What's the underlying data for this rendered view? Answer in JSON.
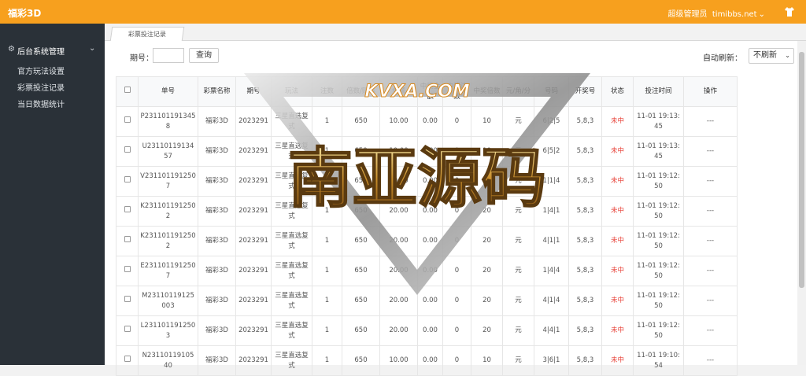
{
  "app": {
    "brand": "福彩3D",
    "user": "超级管理员",
    "site": "timibbs.net"
  },
  "sidebar": {
    "group": "后台系统管理",
    "items": [
      {
        "label": "官方玩法设置"
      },
      {
        "label": "彩票投注记录"
      },
      {
        "label": "当日数据统计"
      }
    ]
  },
  "tab": {
    "label": "彩票投注记录"
  },
  "filter": {
    "issue_label": "期号：",
    "issue_value": "",
    "query_label": "查询"
  },
  "autorefresh": {
    "label": "自动刷新：",
    "value": "不刷新"
  },
  "table": {
    "headers": [
      "",
      "单号",
      "彩票名称",
      "期号",
      "玩法",
      "注数",
      "倍数/赔率",
      "金额",
      "中奖金额",
      "中奖注数",
      "中奖倍数",
      "元/角/分",
      "号码",
      "开奖号",
      "状态",
      "投注时间",
      "操作"
    ],
    "rows": [
      [
        "",
        "P2311011913458",
        "福彩3D",
        "2023291",
        "三星直选复式",
        "1",
        "650",
        "10.00",
        "0.00",
        "0",
        "10",
        "元",
        "6|2|5",
        "5,8,3",
        "未中",
        "11-01 19:13:45",
        "---"
      ],
      [
        "",
        "U2311011913457",
        "福彩3D",
        "2023291",
        "三星直选复式",
        "1",
        "650",
        "10.00",
        "0.00",
        "0",
        "10",
        "元",
        "6|5|2",
        "5,8,3",
        "未中",
        "11-01 19:13:45",
        "---"
      ],
      [
        "",
        "V2311011912507",
        "福彩3D",
        "2023291",
        "三星直选复式",
        "1",
        "650",
        "20.00",
        "0.00",
        "0",
        "20",
        "元",
        "1|1|4",
        "5,8,3",
        "未中",
        "11-01 19:12:50",
        "---"
      ],
      [
        "",
        "K2311011912502",
        "福彩3D",
        "2023291",
        "三星直选复式",
        "1",
        "650",
        "20.00",
        "0.00",
        "0",
        "20",
        "元",
        "1|4|1",
        "5,8,3",
        "未中",
        "11-01 19:12:50",
        "---"
      ],
      [
        "",
        "K2311011912502",
        "福彩3D",
        "2023291",
        "三星直选复式",
        "1",
        "650",
        "20.00",
        "0.00",
        "0",
        "20",
        "元",
        "4|1|1",
        "5,8,3",
        "未中",
        "11-01 19:12:50",
        "---"
      ],
      [
        "",
        "E2311011912507",
        "福彩3D",
        "2023291",
        "三星直选复式",
        "1",
        "650",
        "20.00",
        "0.00",
        "0",
        "20",
        "元",
        "1|4|4",
        "5,8,3",
        "未中",
        "11-01 19:12:50",
        "---"
      ],
      [
        "",
        "M23110119125003",
        "福彩3D",
        "2023291",
        "三星直选复式",
        "1",
        "650",
        "20.00",
        "0.00",
        "0",
        "20",
        "元",
        "4|1|4",
        "5,8,3",
        "未中",
        "11-01 19:12:50",
        "---"
      ],
      [
        "",
        "L2311011912503",
        "福彩3D",
        "2023291",
        "三星直选复式",
        "1",
        "650",
        "20.00",
        "0.00",
        "0",
        "20",
        "元",
        "4|4|1",
        "5,8,3",
        "未中",
        "11-01 19:12:50",
        "---"
      ],
      [
        "",
        "N2311011910540",
        "福彩3D",
        "2023291",
        "三星直选复式",
        "1",
        "650",
        "10.00",
        "0.00",
        "0",
        "10",
        "元",
        "3|6|1",
        "5,8,3",
        "未中",
        "11-01 19:10:54",
        "---"
      ]
    ]
  },
  "watermark": {
    "top_text": "KVXA.COM",
    "main_text": "南亚源码"
  },
  "colors": {
    "topbar": "#f7a01e",
    "sidebar": "#2a3138",
    "status_lost": "#e8443b"
  }
}
